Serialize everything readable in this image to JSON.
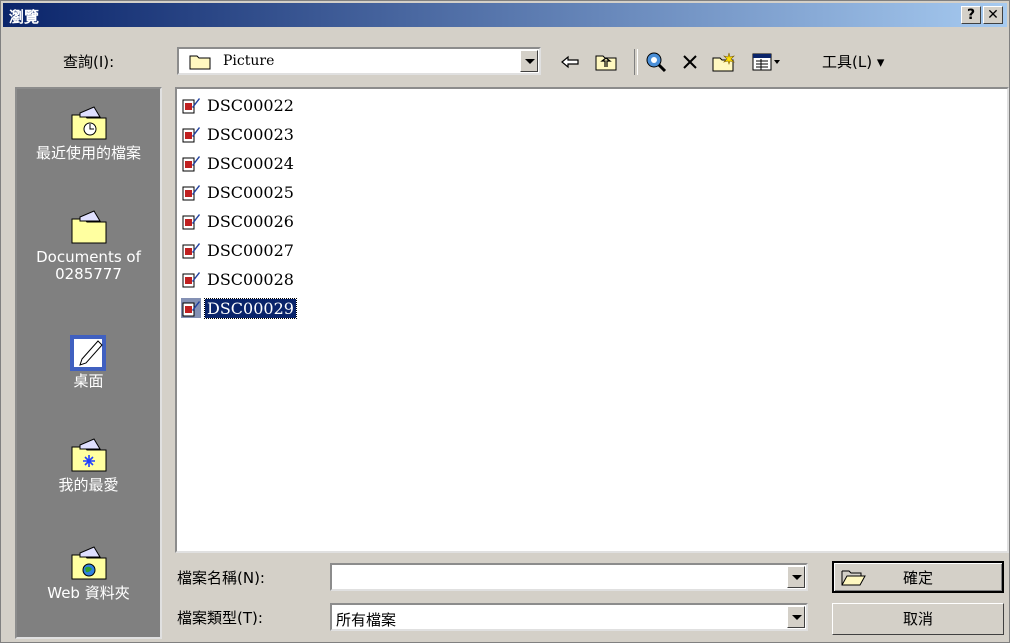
{
  "window": {
    "title": "瀏覽",
    "help_label": "?",
    "close_label": "✕"
  },
  "lookin": {
    "label": "查詢(I):",
    "value": "Picture"
  },
  "toolbar": {
    "tools_label": "工具(L) ▾"
  },
  "places": [
    {
      "label": "最近使用的檔案",
      "icon": "recent-files-icon"
    },
    {
      "label": "Documents of 0285777",
      "icon": "documents-folder-icon"
    },
    {
      "label": "桌面",
      "icon": "desktop-icon"
    },
    {
      "label": "我的最愛",
      "icon": "favorites-icon"
    },
    {
      "label": "Web 資料夾",
      "icon": "web-folder-icon"
    }
  ],
  "files": [
    {
      "name": "DSC00022",
      "selected": false
    },
    {
      "name": "DSC00023",
      "selected": false
    },
    {
      "name": "DSC00024",
      "selected": false
    },
    {
      "name": "DSC00025",
      "selected": false
    },
    {
      "name": "DSC00026",
      "selected": false
    },
    {
      "name": "DSC00027",
      "selected": false
    },
    {
      "name": "DSC00028",
      "selected": false
    },
    {
      "name": "DSC00029",
      "selected": true
    }
  ],
  "filename": {
    "label": "檔案名稱(N):",
    "value": ""
  },
  "filetype": {
    "label": "檔案類型(T):",
    "value": "所有檔案"
  },
  "buttons": {
    "ok": "確定",
    "cancel": "取消"
  },
  "colors": {
    "titlebar": "#0a246a",
    "face": "#d4d0c8",
    "places_bg": "#808080",
    "selection": "#0a246a"
  }
}
